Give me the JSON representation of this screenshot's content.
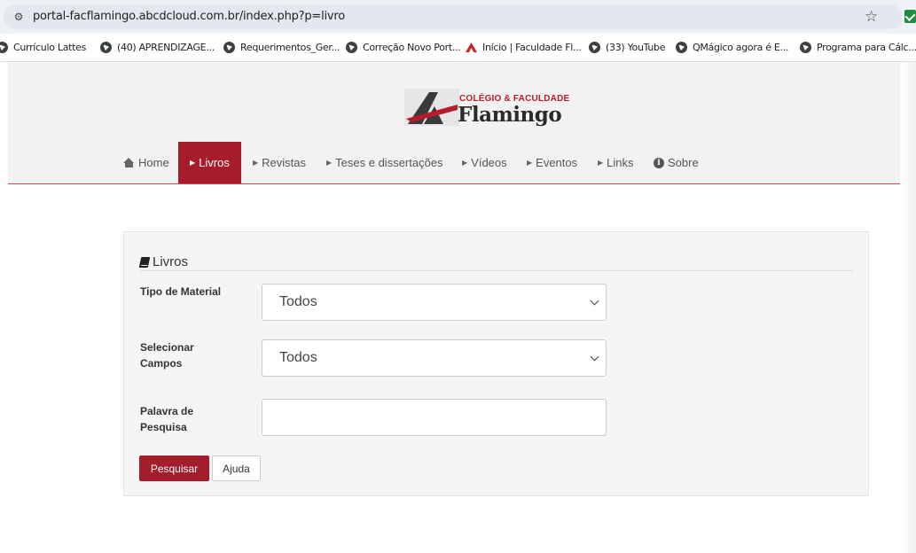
{
  "browser": {
    "url": "portal-facflamingo.abcdcloud.com.br/index.php?p=livro",
    "bookmarks": [
      {
        "label": "Currículo Lattes",
        "icon": "globe-icon"
      },
      {
        "label": "(40) APRENDIZAGE...",
        "icon": "globe-icon"
      },
      {
        "label": "Requerimentos_Ger...",
        "icon": "globe-icon"
      },
      {
        "label": "Correção Novo Port...",
        "icon": "globe-icon"
      },
      {
        "label": "Início | Faculdade Fl...",
        "icon": "flamingo-logo-icon"
      },
      {
        "label": "(33) YouTube",
        "icon": "globe-icon"
      },
      {
        "label": "QMágico agora é E...",
        "icon": "globe-icon"
      },
      {
        "label": "Programa para Cálc...",
        "icon": "globe-icon"
      }
    ]
  },
  "header": {
    "logo_top": "COLÉGIO & FACULDADE",
    "logo_main": "Flamingo",
    "brand_color": "#a51d2d"
  },
  "nav": {
    "items": [
      {
        "label": "Home",
        "icon": "home-icon",
        "active": false
      },
      {
        "label": "Livros",
        "icon": "caret-right-icon",
        "active": true
      },
      {
        "label": "Revistas",
        "icon": "caret-right-icon",
        "active": false
      },
      {
        "label": "Teses e dissertações",
        "icon": "caret-right-icon",
        "active": false
      },
      {
        "label": "Vídeos",
        "icon": "caret-right-icon",
        "active": false
      },
      {
        "label": "Eventos",
        "icon": "caret-right-icon",
        "active": false
      },
      {
        "label": "Links",
        "icon": "caret-right-icon",
        "active": false
      },
      {
        "label": "Sobre",
        "icon": "info-circle-icon",
        "active": false
      }
    ]
  },
  "form": {
    "legend": "Livros",
    "tipo_label": "Tipo de Material",
    "tipo_value": "Todos",
    "campos_label_1": "Selecionar",
    "campos_label_2": "Campos",
    "campos_value": "Todos",
    "palavra_label_1": "Palavra de",
    "palavra_label_2": "Pesquisa",
    "palavra_value": "",
    "search_button": "Pesquisar",
    "help_button": "Ajuda"
  }
}
